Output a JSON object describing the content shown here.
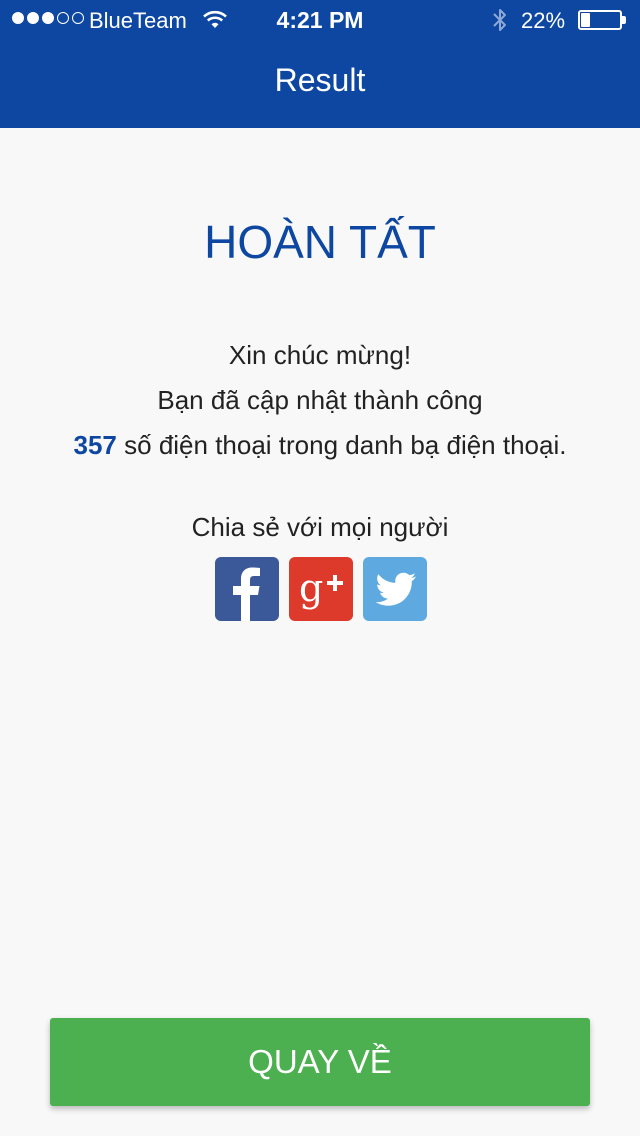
{
  "status_bar": {
    "carrier": "BlueTeam",
    "time": "4:21 PM",
    "battery_percent": "22%",
    "battery_level": 0.22,
    "signal_bars_filled": 3,
    "signal_bars_total": 5,
    "icons": [
      "signal-dots-icon",
      "wifi-icon",
      "bluetooth-icon",
      "battery-icon"
    ]
  },
  "nav": {
    "title": "Result"
  },
  "result": {
    "title": "HOÀN TẤT",
    "line1": "Xin chúc mừng!",
    "line2": "Bạn đã cập nhật thành công",
    "count": "357",
    "line3_suffix": " số điện thoại trong danh bạ điện thoại."
  },
  "share": {
    "label": "Chia sẻ với mọi người",
    "buttons": [
      {
        "name": "facebook",
        "icon": "facebook-icon",
        "color": "#3b5998"
      },
      {
        "name": "google-plus",
        "icon": "google-plus-icon",
        "color": "#dd3a2c"
      },
      {
        "name": "twitter",
        "icon": "twitter-icon",
        "color": "#5eaae0"
      }
    ]
  },
  "footer": {
    "back_label": "QUAY VỀ"
  },
  "colors": {
    "header_bg": "#0d47a1",
    "accent": "#0d47a1",
    "button_bg": "#4caf50",
    "page_bg": "#f8f8f8"
  }
}
